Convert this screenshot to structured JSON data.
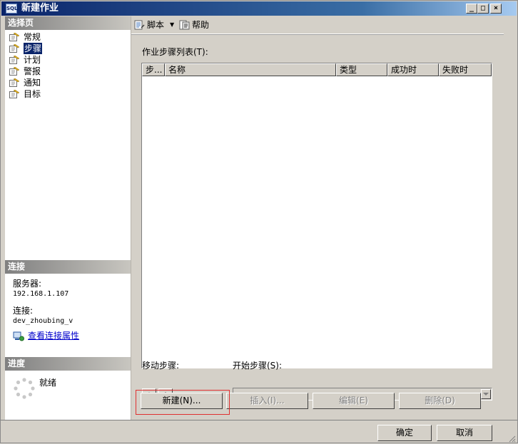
{
  "window": {
    "title": "新建作业",
    "icon": "sql-window-icon"
  },
  "sidebar": {
    "select_page_header": "选择页",
    "items": [
      {
        "label": "常规",
        "selected": false
      },
      {
        "label": "步骤",
        "selected": true
      },
      {
        "label": "计划",
        "selected": false
      },
      {
        "label": "警报",
        "selected": false
      },
      {
        "label": "通知",
        "selected": false
      },
      {
        "label": "目标",
        "selected": false
      }
    ],
    "connection_header": "连接",
    "server_label": "服务器:",
    "server_value": "192.168.1.107",
    "connection_label": "连接:",
    "connection_value": "dev_zhoubing_v",
    "view_connection_link": "查看连接属性",
    "progress_header": "进度",
    "progress_status": "就绪"
  },
  "toolbar": {
    "script_label": "脚本",
    "help_label": "帮助"
  },
  "steps": {
    "list_label": "作业步骤列表(T):",
    "columns": [
      "步...",
      "名称",
      "类型",
      "成功时",
      "失败时"
    ],
    "rows": [],
    "move_label": "移动步骤:",
    "start_label": "开始步骤(S):",
    "start_value": ""
  },
  "buttons": {
    "new": "新建(N)...",
    "insert": "插入(I)...",
    "edit": "编辑(E)",
    "delete": "删除(D)",
    "ok": "确定",
    "cancel": "取消"
  },
  "colors": {
    "title_bar": "#0a246a",
    "selection": "#0a246a",
    "link": "#0000cc",
    "highlight_box": "#e03030"
  }
}
